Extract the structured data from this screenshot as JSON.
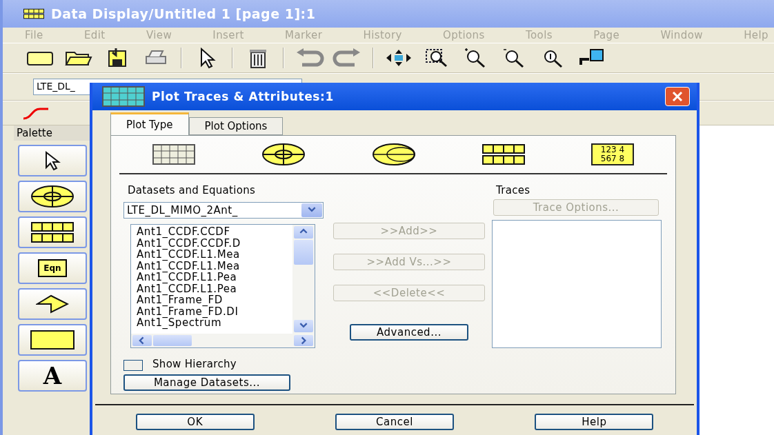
{
  "window": {
    "title": "Data Display/Untitled 1 [page 1]:1"
  },
  "menu": [
    "File",
    "Edit",
    "View",
    "Insert",
    "Marker",
    "History",
    "Options",
    "Tools",
    "Page",
    "Window",
    "Help"
  ],
  "toolbar": [
    {
      "kind": "new"
    },
    {
      "kind": "open"
    },
    {
      "kind": "save"
    },
    {
      "kind": "print"
    },
    {
      "kind": "sep"
    },
    {
      "kind": "pointer"
    },
    {
      "kind": "sep"
    },
    {
      "kind": "delete"
    },
    {
      "kind": "sep"
    },
    {
      "kind": "undo"
    },
    {
      "kind": "redo"
    },
    {
      "kind": "sep"
    },
    {
      "kind": "move"
    },
    {
      "kind": "zoom-box"
    },
    {
      "kind": "zoom-in"
    },
    {
      "kind": "zoom-out"
    },
    {
      "kind": "zoom-1"
    },
    {
      "kind": "export"
    }
  ],
  "dataset_combo": {
    "value": "LTE_DL_"
  },
  "palette": {
    "title": "Palette",
    "items": [
      {
        "kind": "pointer"
      },
      {
        "kind": "polar"
      },
      {
        "kind": "list"
      },
      {
        "kind": "equation",
        "label": "Eqn"
      },
      {
        "kind": "arrow"
      },
      {
        "kind": "rectangle"
      },
      {
        "kind": "text",
        "label": "A"
      }
    ]
  },
  "dialog": {
    "title": "Plot Traces & Attributes:1",
    "tabs": [
      {
        "label": "Plot Type",
        "selected": true
      },
      {
        "label": "Plot Options",
        "selected": false
      }
    ],
    "plot_types": [
      {
        "kind": "rectangular"
      },
      {
        "kind": "polar"
      },
      {
        "kind": "smith"
      },
      {
        "kind": "list"
      },
      {
        "kind": "table",
        "lines": [
          "123 4",
          "567 8"
        ]
      }
    ],
    "datasets_label": "Datasets and Equations",
    "dataset": "LTE_DL_MIMO_2Ant_",
    "items": [
      "Ant1_CCDF.CCDF",
      "Ant1_CCDF.CCDF.D",
      "Ant1_CCDF.L1.Mea",
      "Ant1_CCDF.L1.Mea",
      "Ant1_CCDF.L1.Pea",
      "Ant1_CCDF.L1.Pea",
      "Ant1_Frame_FD",
      "Ant1_Frame_FD.DI",
      "Ant1_Spectrum"
    ],
    "show_hierarchy": {
      "label": "Show Hierarchy",
      "checked": false
    },
    "manage_button": "Manage Datasets...",
    "middle_buttons": [
      {
        "label": ">>Add>>",
        "disabled": true
      },
      {
        "label": ">>Add Vs...>>",
        "disabled": true
      },
      {
        "label": "<<Delete<<",
        "disabled": true
      }
    ],
    "advanced_button": {
      "label": "Advanced...",
      "disabled": false
    },
    "traces_label": "Traces",
    "trace_options": {
      "label": "Trace Options...",
      "disabled": true
    },
    "buttons": [
      "OK",
      "Cancel",
      "Help"
    ]
  }
}
